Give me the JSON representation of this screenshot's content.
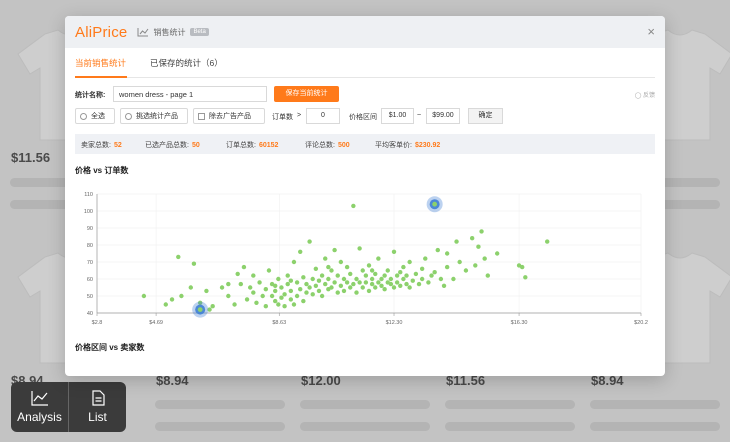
{
  "background": {
    "prices_top": [
      "$11.56"
    ],
    "prices_bottom": [
      "$8.94",
      "$8.94",
      "$12.00",
      "$11.56",
      "$8.94"
    ]
  },
  "float_nav": {
    "analysis_label": "Analysis",
    "list_label": "List"
  },
  "dialog": {
    "logo": "AliPrice",
    "title": "销售统计",
    "beta": "Beta",
    "close_glyph": "×",
    "tabs": [
      "当前销售统计",
      "已保存的统计（6）"
    ],
    "name_label": "统计名称:",
    "name_value": "women dress - page 1",
    "save_label": "保存当前统计",
    "feedback_label": "◯ 反馈",
    "filters": {
      "select_all": "全选",
      "selected_products": "挑选统计产品",
      "exclude_ads": "除去广告产品",
      "orders_label": "订单数",
      "orders_op": ">",
      "orders_value": "0",
      "price_label": "价格区间",
      "price_min": "$1.00",
      "price_sep": "~",
      "price_max": "$99.00",
      "confirm_label": "确定"
    },
    "stats": [
      {
        "label": "卖家总数:",
        "value": "52"
      },
      {
        "label": "已选产品总数:",
        "value": "50"
      },
      {
        "label": "订单总数:",
        "value": "60152"
      },
      {
        "label": "评论总数:",
        "value": "500"
      },
      {
        "label": "平均客单价:",
        "value": "$230.92"
      }
    ],
    "chart_title": "价格 vs 订单数",
    "second_title": "价格区间 vs 卖家数"
  },
  "chart_data": {
    "type": "scatter",
    "title": "价格 vs 订单数",
    "xlim": [
      2.8,
      20.2
    ],
    "ylim": [
      40,
      110
    ],
    "x_ticks": [
      "$2.8",
      "$4.69",
      "$8.63",
      "$12.30",
      "$16.30",
      "$20.2"
    ],
    "y_ticks": [
      "40",
      "50",
      "60",
      "70",
      "80",
      "90",
      "100",
      "110"
    ],
    "grid": true,
    "point_color": "#8cd16c",
    "highlight_color": "#3f7fd4",
    "highlighted": [
      [
        6.1,
        42
      ],
      [
        13.6,
        104
      ]
    ],
    "points": [
      [
        4.3,
        50
      ],
      [
        5.0,
        45
      ],
      [
        5.2,
        48
      ],
      [
        5.4,
        73
      ],
      [
        5.5,
        50
      ],
      [
        5.8,
        55
      ],
      [
        5.9,
        69
      ],
      [
        6.1,
        46
      ],
      [
        6.3,
        53
      ],
      [
        6.4,
        42
      ],
      [
        6.5,
        44
      ],
      [
        6.8,
        55
      ],
      [
        7.0,
        50
      ],
      [
        7.0,
        57
      ],
      [
        7.2,
        45
      ],
      [
        7.3,
        63
      ],
      [
        7.4,
        57
      ],
      [
        7.5,
        67
      ],
      [
        7.6,
        48
      ],
      [
        7.7,
        55
      ],
      [
        7.8,
        52
      ],
      [
        7.8,
        62
      ],
      [
        7.9,
        46
      ],
      [
        8.0,
        58
      ],
      [
        8.1,
        50
      ],
      [
        8.2,
        44
      ],
      [
        8.2,
        54
      ],
      [
        8.3,
        65
      ],
      [
        8.4,
        50
      ],
      [
        8.4,
        57
      ],
      [
        8.5,
        47
      ],
      [
        8.5,
        53
      ],
      [
        8.6,
        45
      ],
      [
        8.6,
        60
      ],
      [
        8.7,
        49
      ],
      [
        8.7,
        55
      ],
      [
        8.8,
        44
      ],
      [
        8.8,
        51
      ],
      [
        8.9,
        62
      ],
      [
        8.9,
        57
      ],
      [
        9.0,
        48
      ],
      [
        9.0,
        53
      ],
      [
        9.1,
        45
      ],
      [
        9.1,
        70
      ],
      [
        9.2,
        50
      ],
      [
        9.2,
        58
      ],
      [
        9.3,
        54
      ],
      [
        9.3,
        76
      ],
      [
        9.4,
        47
      ],
      [
        9.4,
        61
      ],
      [
        9.5,
        52
      ],
      [
        9.5,
        57
      ],
      [
        9.6,
        55
      ],
      [
        9.6,
        82
      ],
      [
        9.7,
        60
      ],
      [
        9.7,
        51
      ],
      [
        9.8,
        56
      ],
      [
        9.8,
        66
      ],
      [
        9.9,
        53
      ],
      [
        9.9,
        59
      ],
      [
        10.0,
        62
      ],
      [
        10.0,
        50
      ],
      [
        10.1,
        57
      ],
      [
        10.1,
        72
      ],
      [
        10.2,
        54
      ],
      [
        10.2,
        60
      ],
      [
        10.3,
        55
      ],
      [
        10.3,
        65
      ],
      [
        10.4,
        58
      ],
      [
        10.4,
        77
      ],
      [
        10.5,
        52
      ],
      [
        10.5,
        62
      ],
      [
        10.6,
        56
      ],
      [
        10.6,
        70
      ],
      [
        10.7,
        53
      ],
      [
        10.7,
        60
      ],
      [
        10.8,
        58
      ],
      [
        10.8,
        67
      ],
      [
        10.9,
        55
      ],
      [
        10.9,
        63
      ],
      [
        11.0,
        57
      ],
      [
        11.0,
        103
      ],
      [
        11.1,
        52
      ],
      [
        11.1,
        60
      ],
      [
        11.2,
        58
      ],
      [
        11.2,
        78
      ],
      [
        11.3,
        55
      ],
      [
        11.3,
        65
      ],
      [
        11.4,
        62
      ],
      [
        11.4,
        58
      ],
      [
        11.5,
        53
      ],
      [
        11.5,
        68
      ],
      [
        11.6,
        57
      ],
      [
        11.6,
        60
      ],
      [
        11.7,
        55
      ],
      [
        11.7,
        63
      ],
      [
        11.8,
        58
      ],
      [
        11.8,
        72
      ],
      [
        11.9,
        56
      ],
      [
        11.9,
        60
      ],
      [
        12.0,
        62
      ],
      [
        12.0,
        54
      ],
      [
        12.1,
        58
      ],
      [
        12.1,
        65
      ],
      [
        12.2,
        57
      ],
      [
        12.2,
        60
      ],
      [
        12.3,
        76
      ],
      [
        12.3,
        55
      ],
      [
        12.4,
        62
      ],
      [
        12.4,
        58
      ],
      [
        12.5,
        64
      ],
      [
        12.5,
        56
      ],
      [
        12.6,
        60
      ],
      [
        12.6,
        67
      ],
      [
        12.7,
        57
      ],
      [
        12.7,
        62
      ],
      [
        12.8,
        55
      ],
      [
        12.8,
        70
      ],
      [
        12.9,
        59
      ],
      [
        13.0,
        63
      ],
      [
        13.1,
        57
      ],
      [
        13.2,
        66
      ],
      [
        13.2,
        60
      ],
      [
        13.3,
        72
      ],
      [
        13.4,
        58
      ],
      [
        13.5,
        62
      ],
      [
        13.6,
        64
      ],
      [
        13.7,
        77
      ],
      [
        13.8,
        60
      ],
      [
        13.9,
        56
      ],
      [
        14.0,
        67
      ],
      [
        14.0,
        75
      ],
      [
        14.2,
        60
      ],
      [
        14.3,
        82
      ],
      [
        14.4,
        70
      ],
      [
        14.6,
        65
      ],
      [
        14.8,
        84
      ],
      [
        14.9,
        68
      ],
      [
        15.0,
        79
      ],
      [
        15.1,
        88
      ],
      [
        15.2,
        72
      ],
      [
        15.3,
        62
      ],
      [
        15.6,
        75
      ],
      [
        16.3,
        68
      ],
      [
        16.4,
        67
      ],
      [
        16.5,
        61
      ],
      [
        17.2,
        82
      ],
      [
        8.5,
        56
      ],
      [
        9.0,
        59
      ],
      [
        10.2,
        67
      ],
      [
        11.6,
        65
      ]
    ]
  }
}
